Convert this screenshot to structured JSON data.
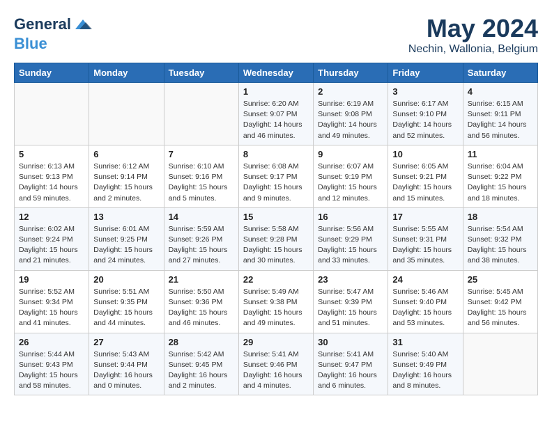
{
  "header": {
    "logo_line1": "General",
    "logo_line2": "Blue",
    "month": "May 2024",
    "location": "Nechin, Wallonia, Belgium"
  },
  "weekdays": [
    "Sunday",
    "Monday",
    "Tuesday",
    "Wednesday",
    "Thursday",
    "Friday",
    "Saturday"
  ],
  "weeks": [
    [
      {
        "day": "",
        "info": ""
      },
      {
        "day": "",
        "info": ""
      },
      {
        "day": "",
        "info": ""
      },
      {
        "day": "1",
        "info": "Sunrise: 6:20 AM\nSunset: 9:07 PM\nDaylight: 14 hours\nand 46 minutes."
      },
      {
        "day": "2",
        "info": "Sunrise: 6:19 AM\nSunset: 9:08 PM\nDaylight: 14 hours\nand 49 minutes."
      },
      {
        "day": "3",
        "info": "Sunrise: 6:17 AM\nSunset: 9:10 PM\nDaylight: 14 hours\nand 52 minutes."
      },
      {
        "day": "4",
        "info": "Sunrise: 6:15 AM\nSunset: 9:11 PM\nDaylight: 14 hours\nand 56 minutes."
      }
    ],
    [
      {
        "day": "5",
        "info": "Sunrise: 6:13 AM\nSunset: 9:13 PM\nDaylight: 14 hours\nand 59 minutes."
      },
      {
        "day": "6",
        "info": "Sunrise: 6:12 AM\nSunset: 9:14 PM\nDaylight: 15 hours\nand 2 minutes."
      },
      {
        "day": "7",
        "info": "Sunrise: 6:10 AM\nSunset: 9:16 PM\nDaylight: 15 hours\nand 5 minutes."
      },
      {
        "day": "8",
        "info": "Sunrise: 6:08 AM\nSunset: 9:17 PM\nDaylight: 15 hours\nand 9 minutes."
      },
      {
        "day": "9",
        "info": "Sunrise: 6:07 AM\nSunset: 9:19 PM\nDaylight: 15 hours\nand 12 minutes."
      },
      {
        "day": "10",
        "info": "Sunrise: 6:05 AM\nSunset: 9:21 PM\nDaylight: 15 hours\nand 15 minutes."
      },
      {
        "day": "11",
        "info": "Sunrise: 6:04 AM\nSunset: 9:22 PM\nDaylight: 15 hours\nand 18 minutes."
      }
    ],
    [
      {
        "day": "12",
        "info": "Sunrise: 6:02 AM\nSunset: 9:24 PM\nDaylight: 15 hours\nand 21 minutes."
      },
      {
        "day": "13",
        "info": "Sunrise: 6:01 AM\nSunset: 9:25 PM\nDaylight: 15 hours\nand 24 minutes."
      },
      {
        "day": "14",
        "info": "Sunrise: 5:59 AM\nSunset: 9:26 PM\nDaylight: 15 hours\nand 27 minutes."
      },
      {
        "day": "15",
        "info": "Sunrise: 5:58 AM\nSunset: 9:28 PM\nDaylight: 15 hours\nand 30 minutes."
      },
      {
        "day": "16",
        "info": "Sunrise: 5:56 AM\nSunset: 9:29 PM\nDaylight: 15 hours\nand 33 minutes."
      },
      {
        "day": "17",
        "info": "Sunrise: 5:55 AM\nSunset: 9:31 PM\nDaylight: 15 hours\nand 35 minutes."
      },
      {
        "day": "18",
        "info": "Sunrise: 5:54 AM\nSunset: 9:32 PM\nDaylight: 15 hours\nand 38 minutes."
      }
    ],
    [
      {
        "day": "19",
        "info": "Sunrise: 5:52 AM\nSunset: 9:34 PM\nDaylight: 15 hours\nand 41 minutes."
      },
      {
        "day": "20",
        "info": "Sunrise: 5:51 AM\nSunset: 9:35 PM\nDaylight: 15 hours\nand 44 minutes."
      },
      {
        "day": "21",
        "info": "Sunrise: 5:50 AM\nSunset: 9:36 PM\nDaylight: 15 hours\nand 46 minutes."
      },
      {
        "day": "22",
        "info": "Sunrise: 5:49 AM\nSunset: 9:38 PM\nDaylight: 15 hours\nand 49 minutes."
      },
      {
        "day": "23",
        "info": "Sunrise: 5:47 AM\nSunset: 9:39 PM\nDaylight: 15 hours\nand 51 minutes."
      },
      {
        "day": "24",
        "info": "Sunrise: 5:46 AM\nSunset: 9:40 PM\nDaylight: 15 hours\nand 53 minutes."
      },
      {
        "day": "25",
        "info": "Sunrise: 5:45 AM\nSunset: 9:42 PM\nDaylight: 15 hours\nand 56 minutes."
      }
    ],
    [
      {
        "day": "26",
        "info": "Sunrise: 5:44 AM\nSunset: 9:43 PM\nDaylight: 15 hours\nand 58 minutes."
      },
      {
        "day": "27",
        "info": "Sunrise: 5:43 AM\nSunset: 9:44 PM\nDaylight: 16 hours\nand 0 minutes."
      },
      {
        "day": "28",
        "info": "Sunrise: 5:42 AM\nSunset: 9:45 PM\nDaylight: 16 hours\nand 2 minutes."
      },
      {
        "day": "29",
        "info": "Sunrise: 5:41 AM\nSunset: 9:46 PM\nDaylight: 16 hours\nand 4 minutes."
      },
      {
        "day": "30",
        "info": "Sunrise: 5:41 AM\nSunset: 9:47 PM\nDaylight: 16 hours\nand 6 minutes."
      },
      {
        "day": "31",
        "info": "Sunrise: 5:40 AM\nSunset: 9:49 PM\nDaylight: 16 hours\nand 8 minutes."
      },
      {
        "day": "",
        "info": ""
      }
    ]
  ]
}
